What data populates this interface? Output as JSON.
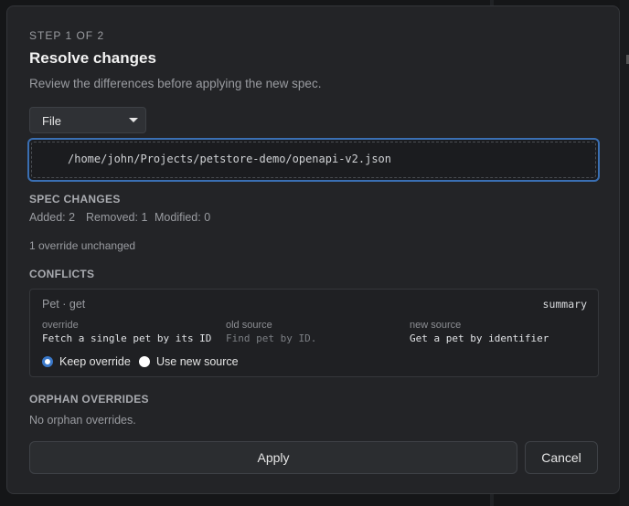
{
  "header": {
    "step": "STEP 1 OF 2",
    "title": "Resolve changes",
    "subtitle": "Review the differences before applying the new spec."
  },
  "source": {
    "selected": "File",
    "path": "/home/john/Projects/petstore-demo/openapi-v2.json"
  },
  "spec_changes": {
    "heading": "SPEC CHANGES",
    "added": "Added: 2",
    "removed": "Removed: 1",
    "modified": "Modified: 0",
    "override_note": "1 override unchanged"
  },
  "conflicts": {
    "heading": "CONFLICTS",
    "items": [
      {
        "title": "Pet · get",
        "field": "summary",
        "override_label": "override",
        "override_value": "Fetch a single pet by its ID",
        "old_label": "old source",
        "old_value": "Find pet by ID.",
        "new_label": "new source",
        "new_value": "Get a pet by identifier",
        "option_keep": "Keep override",
        "option_use_new": "Use new source"
      }
    ]
  },
  "orphans": {
    "heading": "ORPHAN OVERRIDES",
    "empty_text": "No orphan overrides."
  },
  "actions": {
    "apply": "Apply",
    "cancel": "Cancel"
  }
}
